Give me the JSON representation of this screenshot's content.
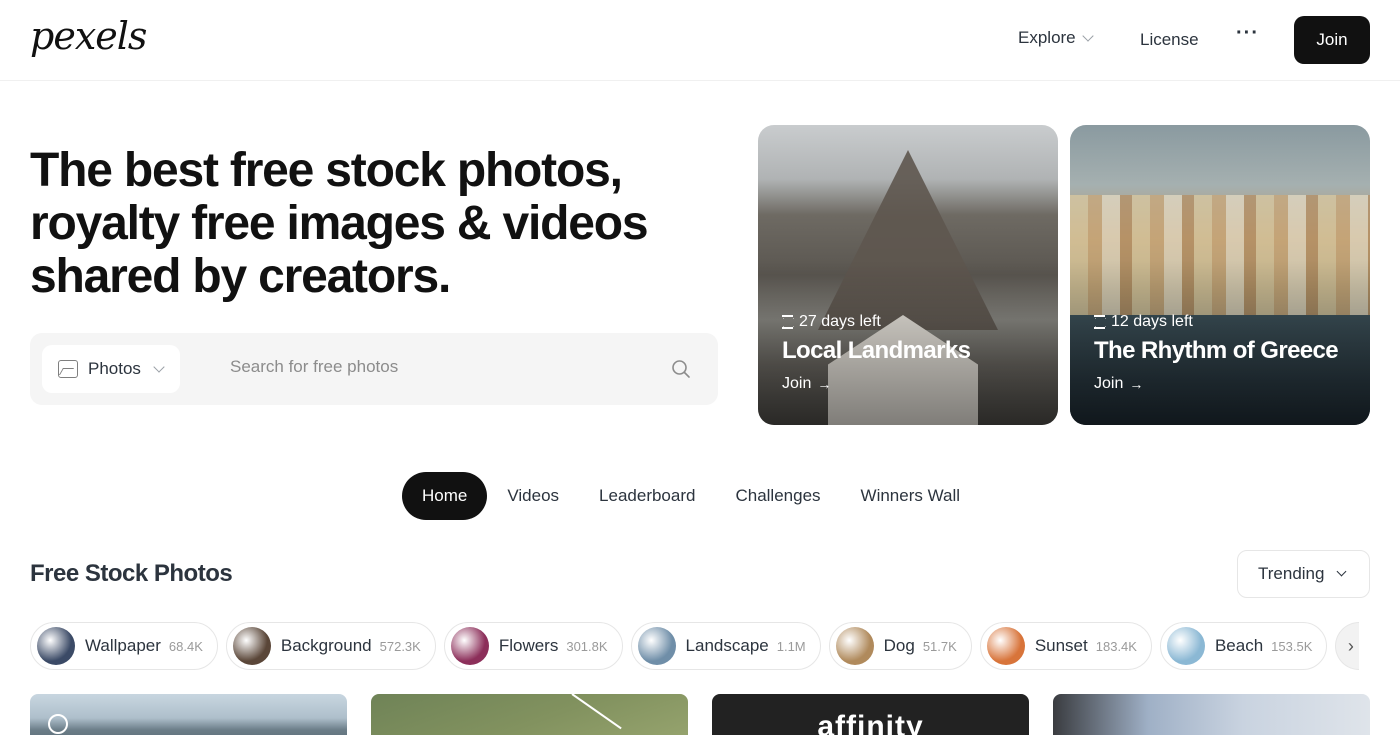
{
  "nav": {
    "logo": "pexels",
    "explore": "Explore",
    "license": "License",
    "more": "···",
    "join": "Join"
  },
  "hero": {
    "title": "The best free stock photos, royalty free images & videos shared by creators.",
    "search_type": "Photos",
    "search_placeholder": "Search for free photos"
  },
  "challenges": [
    {
      "days_left": "27 days left",
      "title": "Local Landmarks",
      "join": "Join"
    },
    {
      "days_left": "12 days left",
      "title": "The Rhythm of Greece",
      "join": "Join"
    }
  ],
  "tabs": [
    {
      "label": "Home",
      "active": true
    },
    {
      "label": "Videos",
      "active": false
    },
    {
      "label": "Leaderboard",
      "active": false
    },
    {
      "label": "Challenges",
      "active": false
    },
    {
      "label": "Winners Wall",
      "active": false
    }
  ],
  "section": {
    "title": "Free Stock Photos",
    "sort": "Trending"
  },
  "categories": [
    {
      "label": "Wallpaper",
      "count": "68.4K",
      "color": "#3b4a66"
    },
    {
      "label": "Background",
      "count": "572.3K",
      "color": "#5a4638"
    },
    {
      "label": "Flowers",
      "count": "301.8K",
      "color": "#8c2f5a"
    },
    {
      "label": "Landscape",
      "count": "1.1M",
      "color": "#6f8ea8"
    },
    {
      "label": "Dog",
      "count": "51.7K",
      "color": "#b08a5c"
    },
    {
      "label": "Sunset",
      "count": "183.4K",
      "color": "#d8743a"
    },
    {
      "label": "Beach",
      "count": "153.5K",
      "color": "#8bb8d4"
    }
  ],
  "photos": {
    "ad_text": "affinity"
  },
  "colors": {
    "accent": "#111111",
    "text": "#2c343e",
    "muted": "#9a9a9a"
  }
}
